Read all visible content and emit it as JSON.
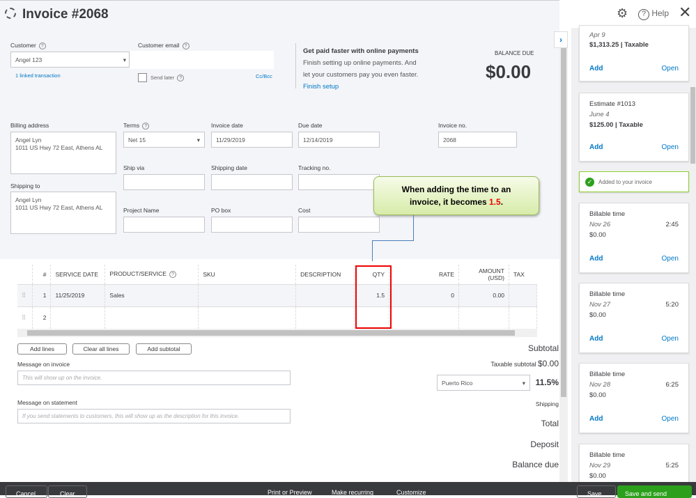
{
  "header": {
    "title": "Invoice #2068",
    "help": "Help"
  },
  "customer": {
    "label": "Customer",
    "value": "Angel 123",
    "linked": "1 linked transaction"
  },
  "email": {
    "label": "Customer email",
    "value": "",
    "send_later": "Send later",
    "ccbcc": "Cc/Bcc"
  },
  "promo": {
    "title": "Get paid faster with online payments",
    "line1": "Finish setting up online payments. And",
    "line2": "let your customers pay you even faster.",
    "link": "Finish setup"
  },
  "balance": {
    "label": "BALANCE DUE",
    "value": "$0.00"
  },
  "billing": {
    "label": "Billing address",
    "line1": "Angel Lyn",
    "line2": "1011 US Hwy 72 East, Athens AL"
  },
  "shipping": {
    "label": "Shipping to",
    "line1": "Angel Lyn",
    "line2": "1011 US Hwy 72 East, Athens AL"
  },
  "fields": {
    "terms_label": "Terms",
    "terms": "Net 15",
    "invoice_date_label": "Invoice date",
    "invoice_date": "11/29/2019",
    "due_date_label": "Due date",
    "due_date": "12/14/2019",
    "invoice_no_label": "Invoice no.",
    "invoice_no": "2068",
    "ship_via": "Ship via",
    "shipping_date": "Shipping date",
    "tracking": "Tracking no.",
    "project": "Project Name",
    "po": "PO box",
    "cost": "Cost"
  },
  "callout": {
    "text": "When adding the time to an invoice, it becomes ",
    "highlight": "1.5",
    "end": "."
  },
  "table": {
    "headers": [
      "#",
      "SERVICE DATE",
      "PRODUCT/SERVICE",
      "SKU",
      "DESCRIPTION",
      "QTY",
      "RATE",
      "AMOUNT (USD)",
      "TAX"
    ],
    "rows": [
      [
        "1",
        "11/25/2019",
        "Sales",
        "",
        "",
        "1.5",
        "0",
        "0.00",
        ""
      ],
      [
        "2",
        "",
        "",
        "",
        "",
        "",
        "",
        "",
        ""
      ]
    ]
  },
  "buttons": {
    "add_lines": "Add lines",
    "clear_lines": "Clear all lines",
    "add_subtotal": "Add subtotal"
  },
  "messages": {
    "invoice_label": "Message on invoice",
    "invoice_ph": "This will show up on the invoice.",
    "statement_label": "Message on statement",
    "statement_ph": "If you send statements to customers, this will show up as the description for this invoice."
  },
  "totals": {
    "subtotal": "Subtotal",
    "taxable": "Taxable subtotal",
    "taxable_value": "$0.00",
    "tax_region": "Puerto Rico",
    "tax_rate": "11.5%",
    "shipping": "Shipping",
    "total": "Total",
    "deposit": "Deposit",
    "balance_due": "Balance due"
  },
  "panel": {
    "cards": [
      {
        "title": "",
        "date": "Apr 9",
        "amount": "$1,313.25 | Taxable",
        "time": ""
      },
      {
        "title": "Estimate #1013",
        "date": "June 4",
        "amount": "$125.00 | Taxable",
        "time": ""
      },
      {
        "title": "Billable time",
        "date": "Nov 26",
        "amount": "$0.00",
        "time": "2:45"
      },
      {
        "title": "Billable time",
        "date": "Nov 27",
        "amount": "$0.00",
        "time": "5:20"
      },
      {
        "title": "Billable time",
        "date": "Nov 28",
        "amount": "$0.00",
        "time": "6:25"
      },
      {
        "title": "Billable time",
        "date": "Nov 29",
        "amount": "$0.00",
        "time": "5:25"
      }
    ],
    "add": "Add",
    "open": "Open",
    "added": "Added to your invoice"
  },
  "footer": {
    "cancel": "Cancel",
    "clear": "Clear",
    "print": "Print or Preview",
    "recurring": "Make recurring",
    "customize": "Customize",
    "save": "Save",
    "save_send": "Save and send"
  }
}
